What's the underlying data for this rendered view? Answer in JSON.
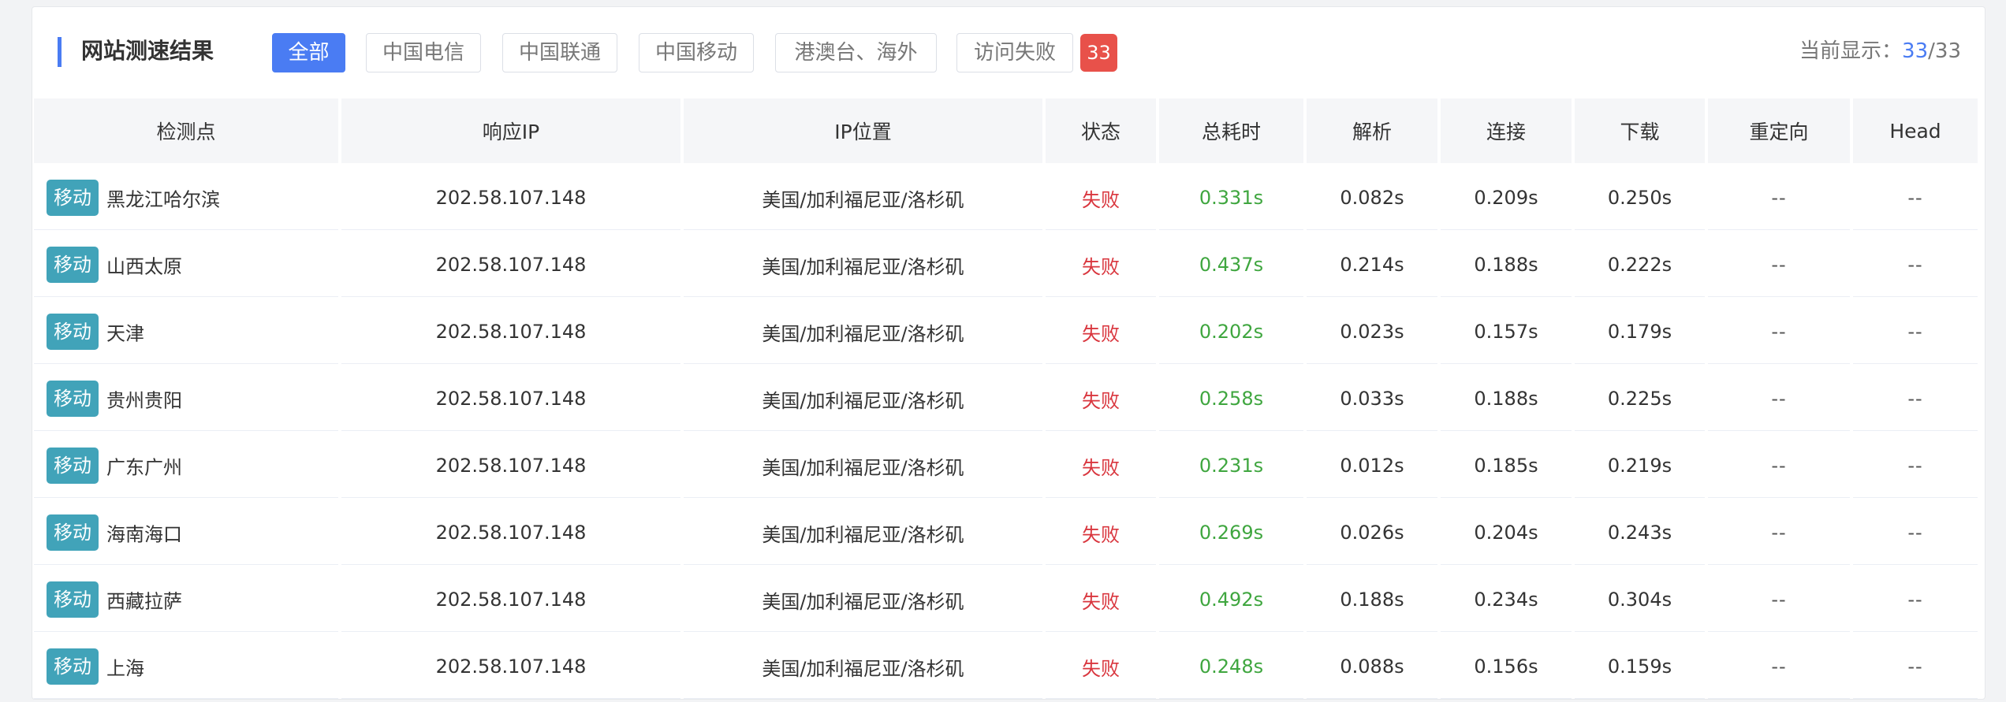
{
  "title": "网站测速结果",
  "tabs": [
    {
      "label": "全部",
      "active": true
    },
    {
      "label": "中国电信",
      "active": false
    },
    {
      "label": "中国联通",
      "active": false
    },
    {
      "label": "中国移动",
      "active": false
    },
    {
      "label": "港澳台、海外",
      "active": false
    },
    {
      "label": "访问失败",
      "active": false
    }
  ],
  "fail_count": "33",
  "summary": {
    "prefix": "当前显示：",
    "shown": "33",
    "separator": "/",
    "total": "33"
  },
  "columns": [
    "检测点",
    "响应IP",
    "IP位置",
    "状态",
    "总耗时",
    "解析",
    "连接",
    "下载",
    "重定向",
    "Head"
  ],
  "rows": [
    {
      "isp": "移动",
      "site": "黑龙江哈尔滨",
      "ip": "202.58.107.148",
      "location": "美国/加利福尼亚/洛杉矶",
      "status": "失败",
      "total": "0.331s",
      "dns": "0.082s",
      "connect": "0.209s",
      "download": "0.250s",
      "redirect": "--",
      "head": "--"
    },
    {
      "isp": "移动",
      "site": "山西太原",
      "ip": "202.58.107.148",
      "location": "美国/加利福尼亚/洛杉矶",
      "status": "失败",
      "total": "0.437s",
      "dns": "0.214s",
      "connect": "0.188s",
      "download": "0.222s",
      "redirect": "--",
      "head": "--"
    },
    {
      "isp": "移动",
      "site": "天津",
      "ip": "202.58.107.148",
      "location": "美国/加利福尼亚/洛杉矶",
      "status": "失败",
      "total": "0.202s",
      "dns": "0.023s",
      "connect": "0.157s",
      "download": "0.179s",
      "redirect": "--",
      "head": "--"
    },
    {
      "isp": "移动",
      "site": "贵州贵阳",
      "ip": "202.58.107.148",
      "location": "美国/加利福尼亚/洛杉矶",
      "status": "失败",
      "total": "0.258s",
      "dns": "0.033s",
      "connect": "0.188s",
      "download": "0.225s",
      "redirect": "--",
      "head": "--"
    },
    {
      "isp": "移动",
      "site": "广东广州",
      "ip": "202.58.107.148",
      "location": "美国/加利福尼亚/洛杉矶",
      "status": "失败",
      "total": "0.231s",
      "dns": "0.012s",
      "connect": "0.185s",
      "download": "0.219s",
      "redirect": "--",
      "head": "--"
    },
    {
      "isp": "移动",
      "site": "海南海口",
      "ip": "202.58.107.148",
      "location": "美国/加利福尼亚/洛杉矶",
      "status": "失败",
      "total": "0.269s",
      "dns": "0.026s",
      "connect": "0.204s",
      "download": "0.243s",
      "redirect": "--",
      "head": "--"
    },
    {
      "isp": "移动",
      "site": "西藏拉萨",
      "ip": "202.58.107.148",
      "location": "美国/加利福尼亚/洛杉矶",
      "status": "失败",
      "total": "0.492s",
      "dns": "0.188s",
      "connect": "0.234s",
      "download": "0.304s",
      "redirect": "--",
      "head": "--"
    },
    {
      "isp": "移动",
      "site": "上海",
      "ip": "202.58.107.148",
      "location": "美国/加利福尼亚/洛杉矶",
      "status": "失败",
      "total": "0.248s",
      "dns": "0.088s",
      "connect": "0.156s",
      "download": "0.159s",
      "redirect": "--",
      "head": "--"
    }
  ],
  "colors": {
    "accent": "#4a7cf3",
    "isp_tag": "#41a3b9",
    "fail": "#d9363e",
    "total_time": "#3fa63f",
    "badge": "#e8514a"
  }
}
